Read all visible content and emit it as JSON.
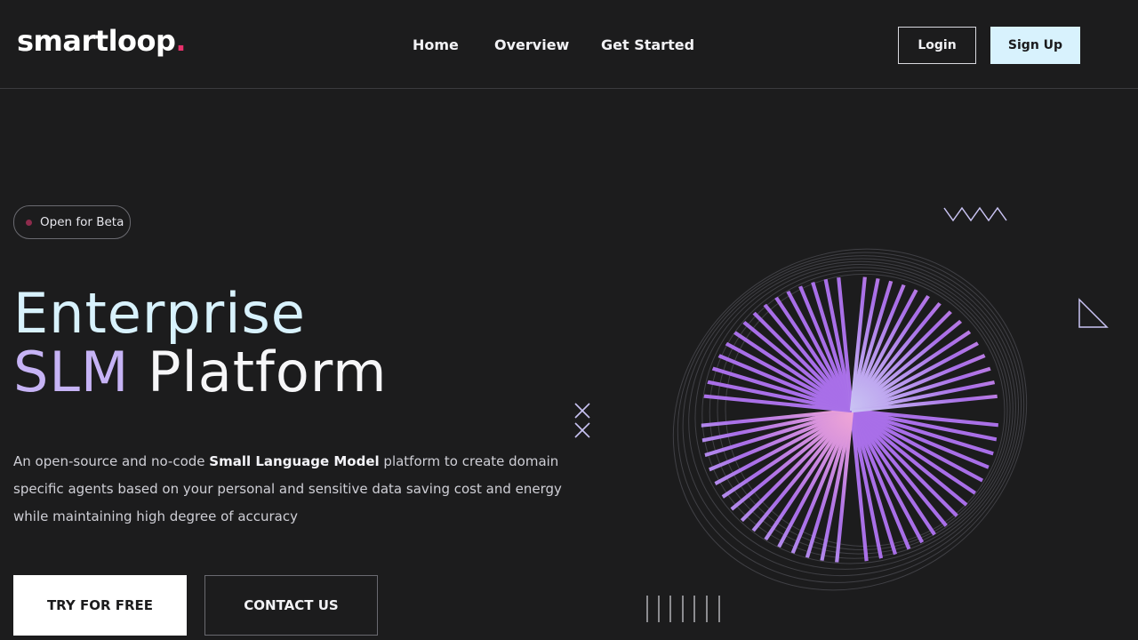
{
  "brand": {
    "name": "smartloop",
    "dot": ".",
    "accent_color": "#e8306b"
  },
  "nav": {
    "items": [
      "Home",
      "Overview",
      "Get Started"
    ]
  },
  "auth": {
    "login_label": "Login",
    "signup_label": "Sign Up"
  },
  "hero": {
    "badge": "Open for Beta",
    "title_line1": "Enterprise",
    "title_line2_a": "SLM",
    "title_line2_b": "Platform",
    "description_prefix": "An open-source and no-code ",
    "description_bold": "Small Language Model",
    "description_suffix": " platform to create domain specific agents based on your personal and sensitive data saving cost and energy while maintaining high degree of accuracy",
    "cta_primary": "TRY FOR FREE",
    "cta_secondary": "CONTACT US"
  },
  "colors": {
    "background": "#1c1c1d",
    "title_light_blue": "#d8f2fd",
    "title_lavender": "#c6b3f5",
    "signup_bg": "#d8f2fd",
    "sphere_pink": "#f0a6d6",
    "sphere_purple": "#a86ee8",
    "sphere_lavender": "#c9c3f3"
  },
  "icons": {
    "zigzag": "zigzag-icon",
    "triangle": "triangle-icon",
    "cross": "cross-icon",
    "lines": "vertical-lines-icon",
    "sphere": "striped-sphere-illustration"
  }
}
